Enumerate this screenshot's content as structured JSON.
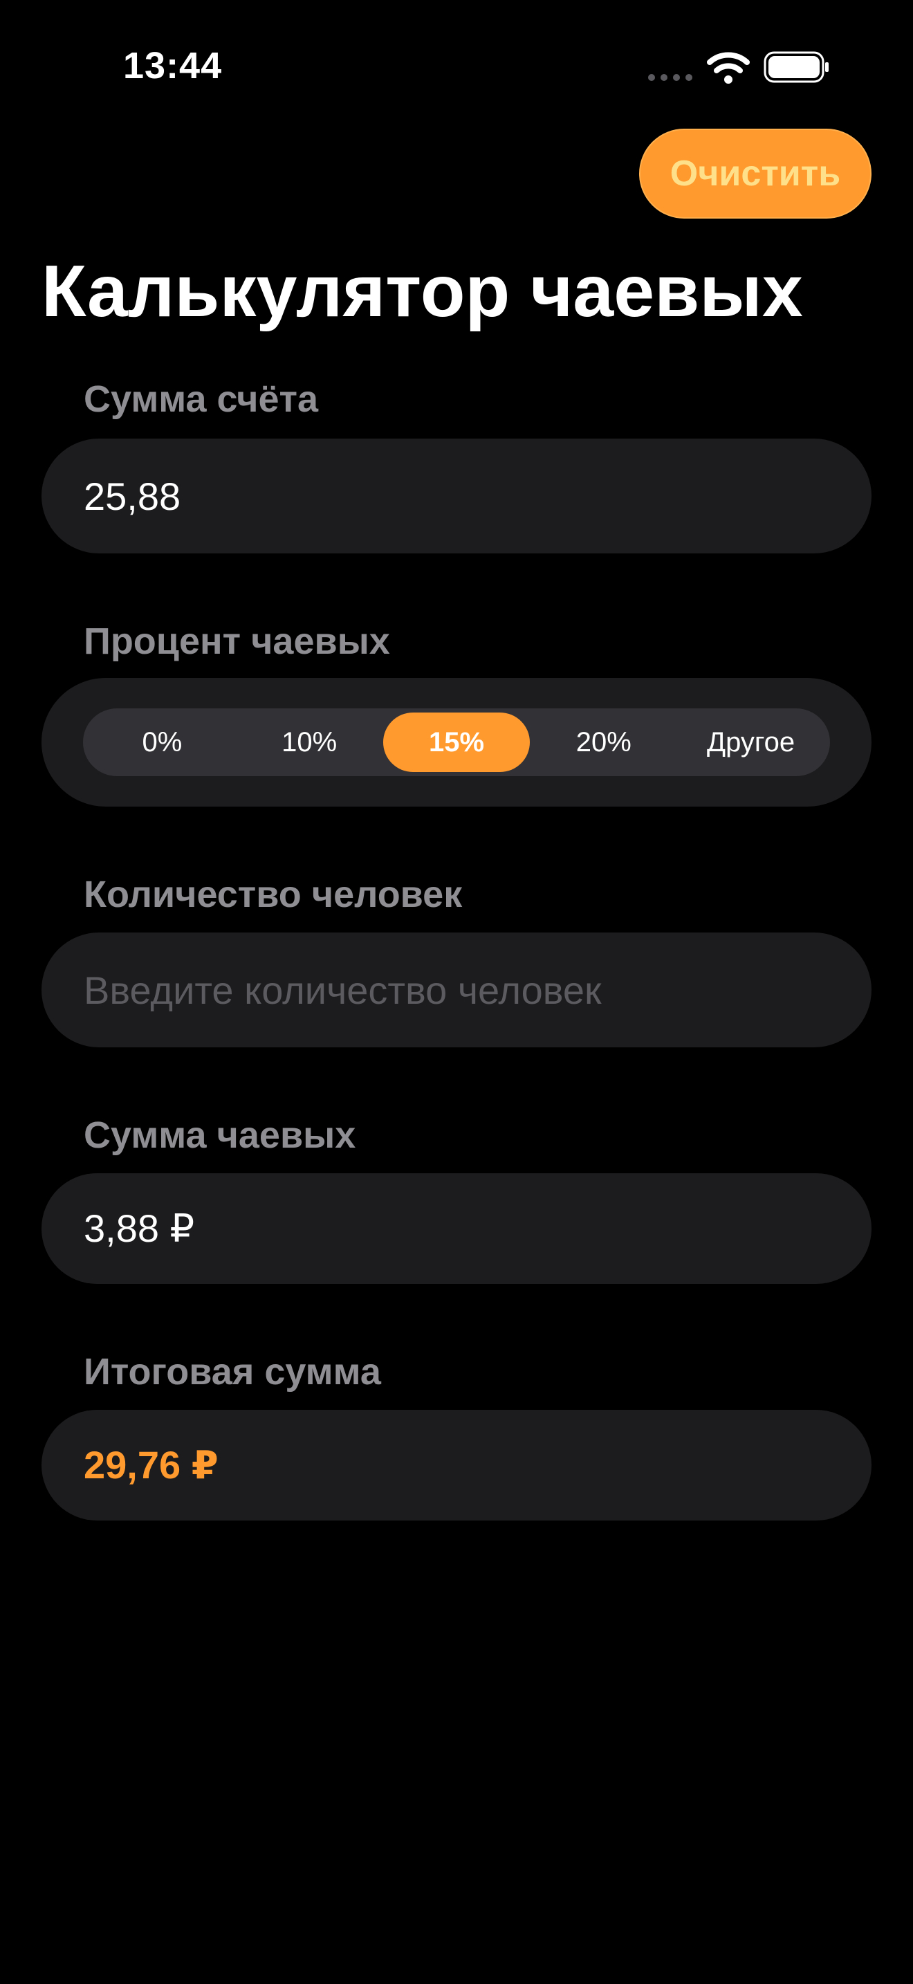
{
  "status_bar": {
    "time": "13:44"
  },
  "header": {
    "clear_label": "Очистить",
    "title": "Калькулятор чаевых"
  },
  "bill": {
    "label": "Сумма счёта",
    "value": "25,88"
  },
  "tip_percent": {
    "label": "Процент чаевых",
    "options": [
      "0%",
      "10%",
      "15%",
      "20%",
      "Другое"
    ],
    "selected": "15%"
  },
  "people": {
    "label": "Количество человек",
    "value": "",
    "placeholder": "Введите количество человек"
  },
  "tip_amount": {
    "label": "Сумма чаевых",
    "value": "3,88 ₽"
  },
  "total": {
    "label": "Итоговая сумма",
    "value": "29,76 ₽"
  },
  "colors": {
    "accent": "#ff9a2e",
    "background": "#000000",
    "card": "#1c1c1e",
    "label": "#8e8e93"
  },
  "icons": {
    "signal": "cellular-signal-icon",
    "wifi": "wifi-icon",
    "battery": "battery-icon"
  }
}
